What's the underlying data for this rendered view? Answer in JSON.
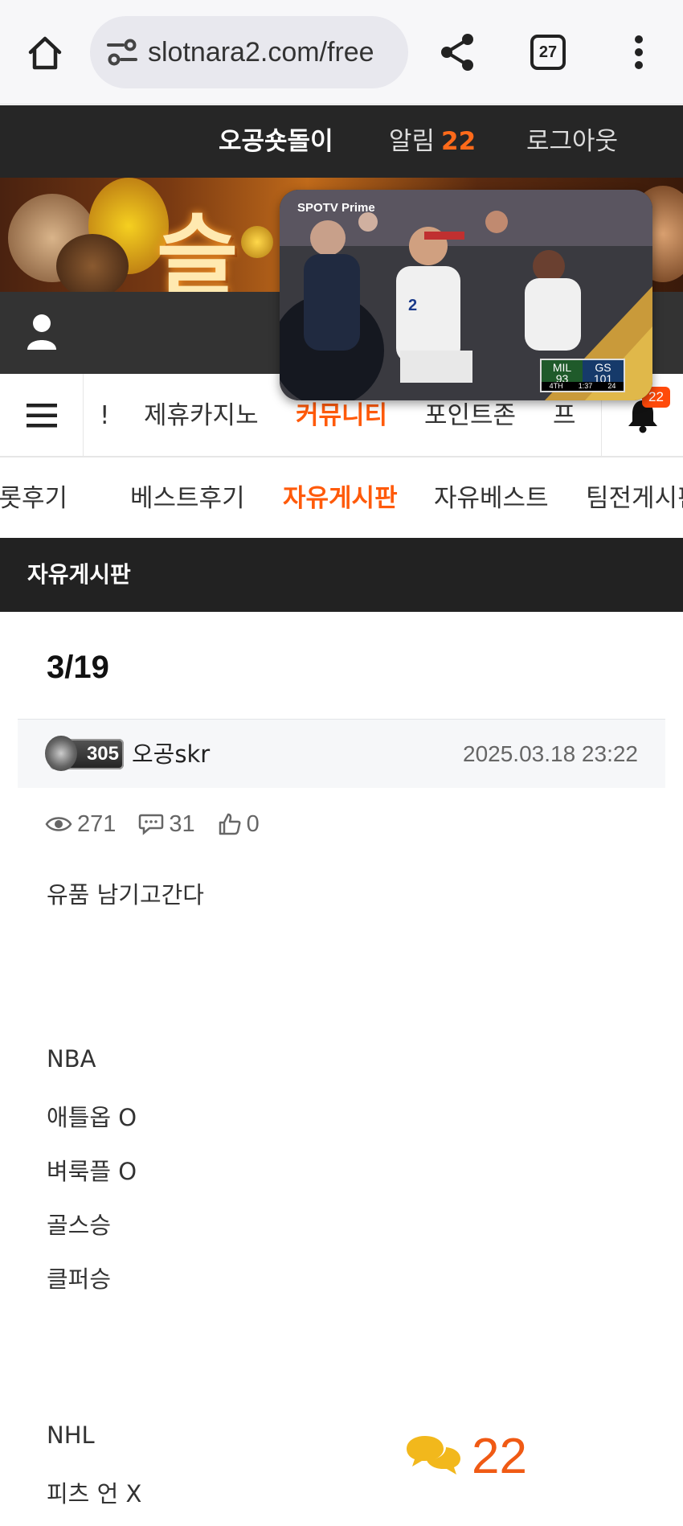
{
  "browser": {
    "url": "slotnara2.com/free",
    "tab_count": "27"
  },
  "topbar": {
    "username": "오공숏돌이",
    "alarm_label": "알림",
    "alarm_count": "22",
    "logout_label": "로그아웃"
  },
  "banner": {
    "logo_text": "슬"
  },
  "main_nav": {
    "items": [
      {
        "label": "!"
      },
      {
        "label": "제휴카지노"
      },
      {
        "label": "커뮤니티"
      },
      {
        "label": "포인트존"
      },
      {
        "label": "프"
      }
    ],
    "active_index": 2,
    "notification_count": "22"
  },
  "sub_nav": {
    "items": [
      {
        "label": "슬롯후기"
      },
      {
        "label": "베스트후기"
      },
      {
        "label": "자유게시판"
      },
      {
        "label": "자유베스트"
      },
      {
        "label": "팀전게시판"
      }
    ],
    "active_index": 2
  },
  "board": {
    "title": "자유게시판"
  },
  "post": {
    "title": "3/19",
    "author_level": "305",
    "author": "오공skr",
    "date": "2025.03.18 23:22",
    "views": "271",
    "comments": "31",
    "likes": "0",
    "body_lines": [
      "유품 남기고간다",
      "NBA",
      "애틀옵 O",
      "벼룩플 O",
      "골스승",
      "클퍼승",
      "NHL",
      "피츠 언 X"
    ]
  },
  "pip_video": {
    "brand": "SPOTV Prime",
    "team1": "MIL",
    "score1": "93",
    "team2": "GS",
    "score2": "101",
    "quarter": "4TH",
    "clock": "1:37",
    "shot_clock": "24"
  },
  "floating_comments": {
    "count": "22"
  },
  "colors": {
    "accent": "#ff5a0a",
    "topbar_bg": "#262626",
    "board_header_bg": "#222222"
  }
}
